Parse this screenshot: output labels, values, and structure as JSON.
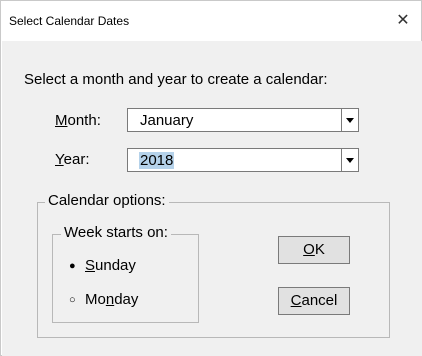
{
  "window": {
    "title": "Select Calendar Dates",
    "close_glyph": "✕"
  },
  "prompt": "Select a month and year to create a calendar:",
  "month": {
    "label_pre": "",
    "label_u": "M",
    "label_post": "onth:",
    "value": "January"
  },
  "year": {
    "label_pre": "",
    "label_u": "Y",
    "label_post": "ear:",
    "value": "2018"
  },
  "calendar_options": {
    "title": "Calendar options:",
    "week_starts": {
      "title": "Week starts on:",
      "options": [
        {
          "pre": "",
          "u": "S",
          "post": "unday",
          "selected": true
        },
        {
          "pre": "Mo",
          "u": "n",
          "post": "day",
          "selected": false
        }
      ]
    }
  },
  "buttons": {
    "ok": {
      "pre": "",
      "u": "O",
      "post": "K"
    },
    "cancel": {
      "pre": "",
      "u": "C",
      "post": "ancel"
    }
  }
}
